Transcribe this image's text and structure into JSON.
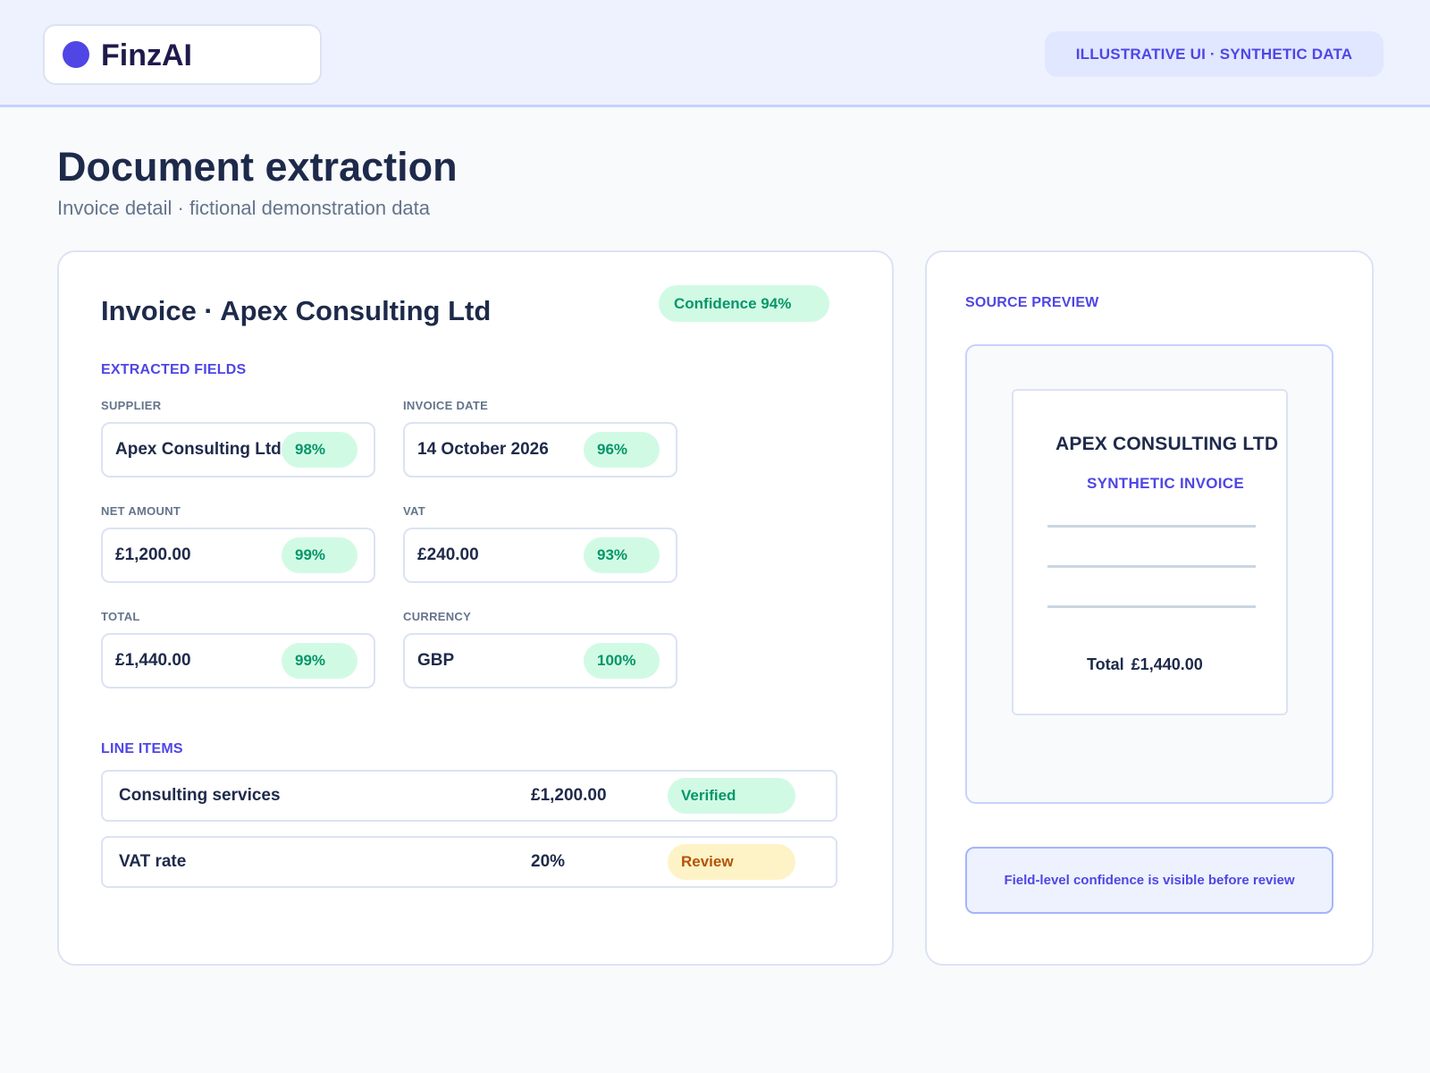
{
  "app": {
    "name": "FinzAI",
    "notice": "ILLUSTRATIVE UI · SYNTHETIC DATA"
  },
  "colors": {
    "accent": "#4f46e5",
    "success": "#059669",
    "success_bg": "#d1fae5",
    "warning": "#b45309",
    "warning_bg": "#fef3c7"
  },
  "page": {
    "title": "Document extraction",
    "subtitle": "Invoice detail · fictional demonstration data"
  },
  "invoice": {
    "title": "Invoice · Apex Consulting Ltd",
    "confidence": "Confidence 94%"
  },
  "extracted": {
    "section_label": "EXTRACTED FIELDS",
    "fields": [
      {
        "label": "SUPPLIER",
        "value": "Apex Consulting Ltd",
        "confidence": "98%"
      },
      {
        "label": "INVOICE DATE",
        "value": "14 October 2026",
        "confidence": "96%"
      },
      {
        "label": "NET AMOUNT",
        "value": "£1,200.00",
        "confidence": "99%"
      },
      {
        "label": "VAT",
        "value": "£240.00",
        "confidence": "93%"
      },
      {
        "label": "TOTAL",
        "value": "£1,440.00",
        "confidence": "99%"
      },
      {
        "label": "CURRENCY",
        "value": "GBP",
        "confidence": "100%"
      }
    ]
  },
  "line_items": {
    "section_label": "LINE ITEMS",
    "rows": [
      {
        "name": "Consulting services",
        "amount": "£1,200.00",
        "status": "Verified"
      },
      {
        "name": "VAT rate",
        "amount": "20%",
        "status": "Review"
      }
    ]
  },
  "preview": {
    "section_label": "SOURCE PREVIEW",
    "company": "APEX CONSULTING LTD",
    "doc_kind": "SYNTHETIC INVOICE",
    "total_label": "Total",
    "total_value": "£1,440.00",
    "note": "Field-level confidence is visible before review"
  }
}
